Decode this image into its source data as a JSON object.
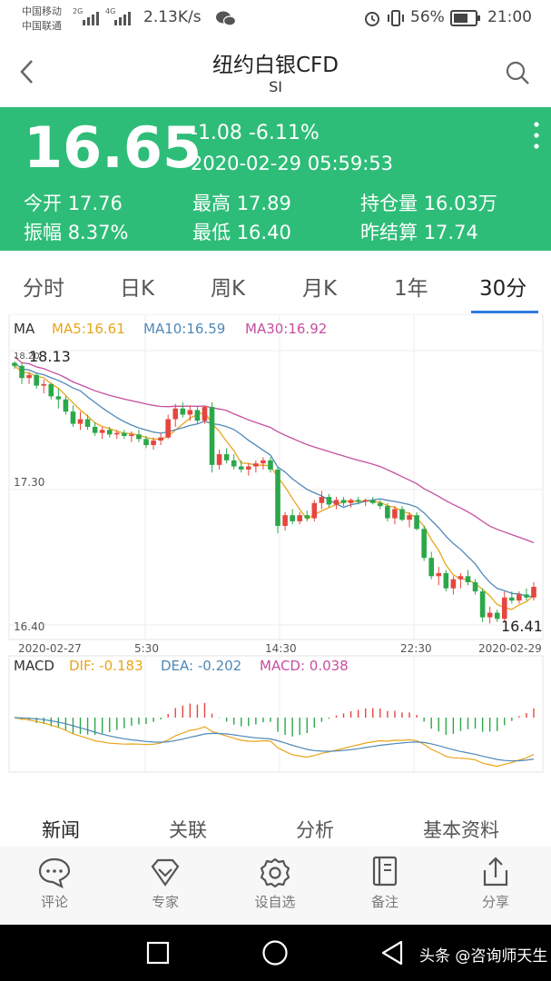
{
  "statusbar": {
    "carrier1": "中国移动",
    "carrier2": "中国联通",
    "net1": "2G",
    "net2": "4G",
    "speed": "2.13K/s",
    "battery": "56%",
    "time": "21:00"
  },
  "nav": {
    "title": "纽约白银CFD",
    "subtitle": "SI"
  },
  "quote": {
    "price": "16.65",
    "change": "-1.08 -6.11%",
    "datetime": "2020-02-29 05:59:53",
    "open_label": "今开",
    "open_value": "17.76",
    "high_label": "最高",
    "high_value": "17.89",
    "oi_label": "持仓量",
    "oi_value": "16.03万",
    "amp_label": "振幅",
    "amp_value": "8.37%",
    "low_label": "最低",
    "low_value": "16.40",
    "settle_label": "昨结算",
    "settle_value": "17.74"
  },
  "tabs": [
    "分时",
    "日K",
    "周K",
    "月K",
    "1年",
    "30分"
  ],
  "active_tab": 5,
  "chart_data": {
    "type": "candlestick",
    "ma_label": "MA",
    "ma5": "MA5:16.61",
    "ma10": "MA10:16.59",
    "ma30": "MA30:16.92",
    "y_ticks": [
      "18.20",
      "17.30",
      "16.40"
    ],
    "y_range": [
      16.4,
      18.2
    ],
    "x_ticks": [
      "2020-02-27",
      "5:30",
      "14:30",
      "22:30",
      "2020-02-29"
    ],
    "max_label": "18.13",
    "min_label": "16.41",
    "candles": [
      [
        18.12,
        18.13,
        18.08,
        18.1
      ],
      [
        18.1,
        18.12,
        17.98,
        18.02
      ],
      [
        18.02,
        18.06,
        17.98,
        18.04
      ],
      [
        18.04,
        18.05,
        17.95,
        17.97
      ],
      [
        17.97,
        18.01,
        17.92,
        17.98
      ],
      [
        17.98,
        17.99,
        17.88,
        17.9
      ],
      [
        17.9,
        17.95,
        17.82,
        17.88
      ],
      [
        17.88,
        17.9,
        17.78,
        17.8
      ],
      [
        17.8,
        17.84,
        17.7,
        17.72
      ],
      [
        17.72,
        17.8,
        17.68,
        17.75
      ],
      [
        17.75,
        17.78,
        17.68,
        17.7
      ],
      [
        17.7,
        17.73,
        17.64,
        17.66
      ],
      [
        17.66,
        17.7,
        17.62,
        17.68
      ],
      [
        17.68,
        17.7,
        17.63,
        17.65
      ],
      [
        17.65,
        17.68,
        17.62,
        17.66
      ],
      [
        17.66,
        17.68,
        17.62,
        17.64
      ],
      [
        17.64,
        17.67,
        17.6,
        17.65
      ],
      [
        17.65,
        17.68,
        17.6,
        17.62
      ],
      [
        17.62,
        17.64,
        17.56,
        17.58
      ],
      [
        17.58,
        17.63,
        17.55,
        17.61
      ],
      [
        17.61,
        17.66,
        17.58,
        17.63
      ],
      [
        17.63,
        17.78,
        17.62,
        17.75
      ],
      [
        17.75,
        17.85,
        17.7,
        17.82
      ],
      [
        17.82,
        17.86,
        17.76,
        17.78
      ],
      [
        17.78,
        17.84,
        17.74,
        17.81
      ],
      [
        17.81,
        17.83,
        17.72,
        17.74
      ],
      [
        17.74,
        17.84,
        17.72,
        17.83
      ],
      [
        17.83,
        17.86,
        17.4,
        17.45
      ],
      [
        17.45,
        17.55,
        17.42,
        17.52
      ],
      [
        17.52,
        17.56,
        17.46,
        17.48
      ],
      [
        17.48,
        17.52,
        17.42,
        17.44
      ],
      [
        17.44,
        17.48,
        17.4,
        17.42
      ],
      [
        17.42,
        17.46,
        17.38,
        17.44
      ],
      [
        17.44,
        17.48,
        17.4,
        17.46
      ],
      [
        17.46,
        17.5,
        17.42,
        17.48
      ],
      [
        17.48,
        17.5,
        17.4,
        17.42
      ],
      [
        17.42,
        17.44,
        17.0,
        17.05
      ],
      [
        17.05,
        17.14,
        17.02,
        17.12
      ],
      [
        17.12,
        17.16,
        17.06,
        17.08
      ],
      [
        17.08,
        17.14,
        17.06,
        17.12
      ],
      [
        17.12,
        17.15,
        17.08,
        17.1
      ],
      [
        17.1,
        17.22,
        17.08,
        17.2
      ],
      [
        17.2,
        17.28,
        17.16,
        17.24
      ],
      [
        17.24,
        17.26,
        17.17,
        17.19
      ],
      [
        17.19,
        17.24,
        17.16,
        17.22
      ],
      [
        17.22,
        17.24,
        17.18,
        17.2
      ],
      [
        17.2,
        17.23,
        17.17,
        17.22
      ],
      [
        17.22,
        17.24,
        17.19,
        17.21
      ],
      [
        17.21,
        17.23,
        17.18,
        17.22
      ],
      [
        17.22,
        17.24,
        17.19,
        17.2
      ],
      [
        17.2,
        17.22,
        17.16,
        17.18
      ],
      [
        17.18,
        17.2,
        17.08,
        17.1
      ],
      [
        17.1,
        17.18,
        17.06,
        17.16
      ],
      [
        17.16,
        17.18,
        17.08,
        17.09
      ],
      [
        17.09,
        17.14,
        17.04,
        17.12
      ],
      [
        17.12,
        17.14,
        17.02,
        17.03
      ],
      [
        17.03,
        17.05,
        16.82,
        16.84
      ],
      [
        16.84,
        16.88,
        16.7,
        16.72
      ],
      [
        16.72,
        16.78,
        16.66,
        16.74
      ],
      [
        16.74,
        16.76,
        16.62,
        16.64
      ],
      [
        16.64,
        16.72,
        16.6,
        16.7
      ],
      [
        16.7,
        16.74,
        16.64,
        16.72
      ],
      [
        16.72,
        16.76,
        16.66,
        16.68
      ],
      [
        16.68,
        16.7,
        16.6,
        16.62
      ],
      [
        16.62,
        16.64,
        16.42,
        16.45
      ],
      [
        16.45,
        16.52,
        16.41,
        16.48
      ],
      [
        16.48,
        16.5,
        16.42,
        16.44
      ],
      [
        16.44,
        16.62,
        16.42,
        16.58
      ],
      [
        16.58,
        16.62,
        16.54,
        16.56
      ],
      [
        16.56,
        16.62,
        16.54,
        16.6
      ],
      [
        16.6,
        16.64,
        16.56,
        16.58
      ],
      [
        16.58,
        16.68,
        16.56,
        16.65
      ]
    ],
    "macd_label": "MACD",
    "dif": "DIF: -0.183",
    "dea": "DEA: -0.202",
    "macd": "MACD: 0.038"
  },
  "colors": {
    "green": "#2ebd78",
    "up": "#e5463f",
    "down": "#2ba84a",
    "ma5": "#e8a51b",
    "ma10": "#4f88b8",
    "ma30": "#c54f9e",
    "tab_active": "#2f7be0"
  },
  "bottom_tabs": [
    "新闻",
    "关联",
    "分析",
    "基本资料"
  ],
  "toolbar": [
    {
      "icon": "comment-icon",
      "label": "评论"
    },
    {
      "icon": "expert-icon",
      "label": "专家"
    },
    {
      "icon": "gear-icon",
      "label": "设自选"
    },
    {
      "icon": "notebook-icon",
      "label": "备注"
    },
    {
      "icon": "share-icon",
      "label": "分享"
    }
  ],
  "watermark": "头条 @咨询师天生"
}
